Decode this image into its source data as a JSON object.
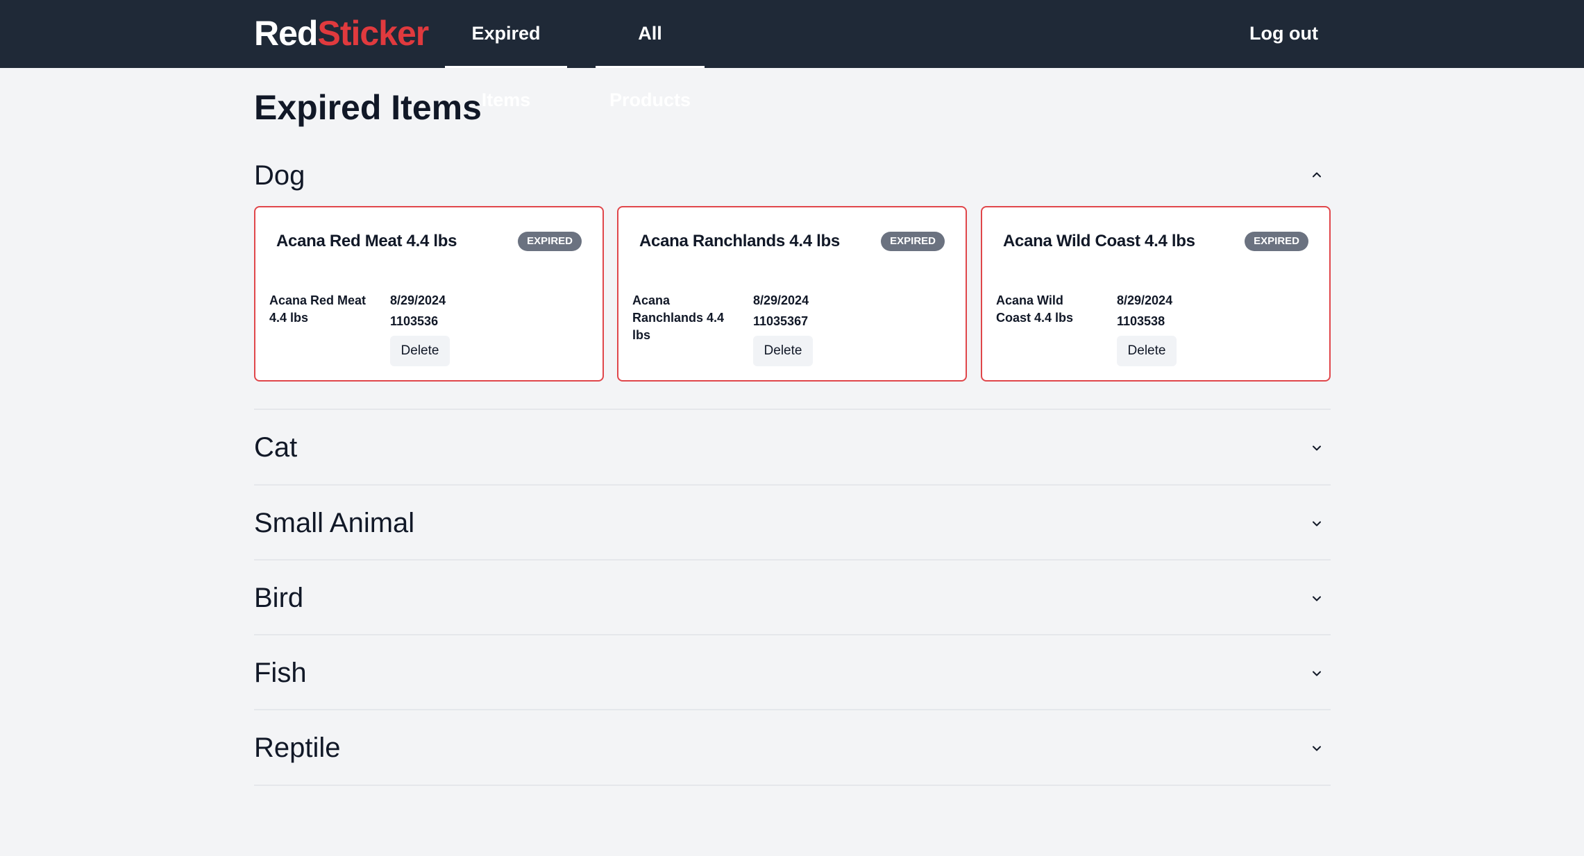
{
  "nav": {
    "logo_part1": "Red",
    "logo_part2": "Sticker",
    "links": [
      {
        "label": "Expired Items"
      },
      {
        "label": "All Products"
      }
    ],
    "logout_label": "Log out"
  },
  "page": {
    "title": "Expired Items"
  },
  "sections": [
    {
      "title": "Dog",
      "chevron": "chevron-up-icon",
      "items": [
        {
          "name": "Acana Red Meat 4.4 lbs",
          "badge": "EXPIRED",
          "image_alt": "Acana Red Meat 4.4 lbs",
          "date": "8/29/2024",
          "sku": "1103536",
          "delete_label": "Delete"
        },
        {
          "name": "Acana Ranchlands 4.4 lbs",
          "badge": "EXPIRED",
          "image_alt": "Acana Ranchlands 4.4 lbs",
          "date": "8/29/2024",
          "sku": "11035367",
          "delete_label": "Delete"
        },
        {
          "name": "Acana Wild Coast 4.4 lbs",
          "badge": "EXPIRED",
          "image_alt": "Acana Wild Coast 4.4 lbs",
          "date": "8/29/2024",
          "sku": "1103538",
          "delete_label": "Delete"
        }
      ]
    },
    {
      "title": "Cat",
      "chevron": "chevron-down-icon"
    },
    {
      "title": "Small Animal",
      "chevron": "chevron-down-icon"
    },
    {
      "title": "Bird",
      "chevron": "chevron-down-icon"
    },
    {
      "title": "Fish",
      "chevron": "chevron-down-icon"
    },
    {
      "title": "Reptile",
      "chevron": "chevron-down-icon"
    }
  ],
  "colors": {
    "nav_bg": "#1f2937",
    "brand_red": "#e03a3e",
    "card_border": "#e0464a",
    "badge_bg": "#6b7280",
    "page_bg": "#f3f4f6"
  }
}
